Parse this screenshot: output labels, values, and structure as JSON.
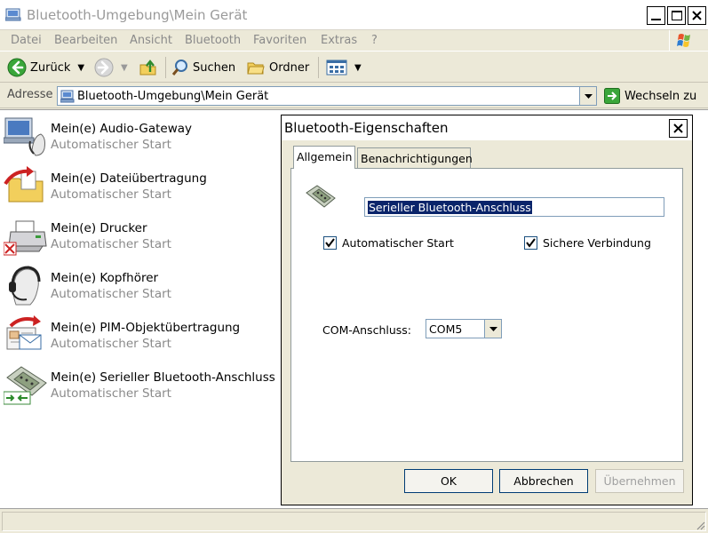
{
  "window": {
    "title": "Bluetooth-Umgebung\\Mein Gerät",
    "controls": {
      "minimize": "_",
      "maximize": "□",
      "close": "X"
    }
  },
  "menu": [
    "Datei",
    "Bearbeiten",
    "Ansicht",
    "Bluetooth",
    "Favoriten",
    "Extras",
    "?"
  ],
  "toolbar": {
    "back_label": "Zurück",
    "search_label": "Suchen",
    "folders_label": "Ordner"
  },
  "address": {
    "label": "Adresse",
    "value": "Bluetooth-Umgebung\\Mein Gerät",
    "go_label": "Wechseln zu"
  },
  "devices": [
    {
      "name": "Mein(e) Audio-Gateway",
      "status": "Automatischer Start",
      "icon": "audio-gateway-icon"
    },
    {
      "name": "Mein(e) Dateiübertragung",
      "status": "Automatischer Start",
      "icon": "file-transfer-icon"
    },
    {
      "name": "Mein(e) Drucker",
      "status": "Automatischer Start",
      "icon": "printer-icon"
    },
    {
      "name": "Mein(e) Kopfhörer",
      "status": "Automatischer Start",
      "icon": "headset-icon"
    },
    {
      "name": "Mein(e) PIM-Objektübertragung",
      "status": "Automatischer Start",
      "icon": "pim-transfer-icon"
    },
    {
      "name": "Mein(e) Serieller Bluetooth-Anschluss",
      "status": "Automatischer Start",
      "icon": "serial-port-icon"
    }
  ],
  "dialog": {
    "title": "Bluetooth-Eigenschaften",
    "close": "X",
    "tabs": [
      "Allgemein",
      "Benachrichtigungen"
    ],
    "active_tab": "Allgemein",
    "name_value": "Serieller Bluetooth-Anschluss",
    "auto_start_label": "Automatischer Start",
    "auto_start_checked": true,
    "secure_label": "Sichere Verbindung",
    "secure_checked": true,
    "com_label": "COM-Anschluss:",
    "com_value": "COM5",
    "ok_label": "OK",
    "cancel_label": "Abbrechen",
    "apply_label": "Übernehmen"
  },
  "colors": {
    "selection": "#0a246a",
    "window_bg": "#ece9d8",
    "disabled_text": "#a0a0a0"
  }
}
